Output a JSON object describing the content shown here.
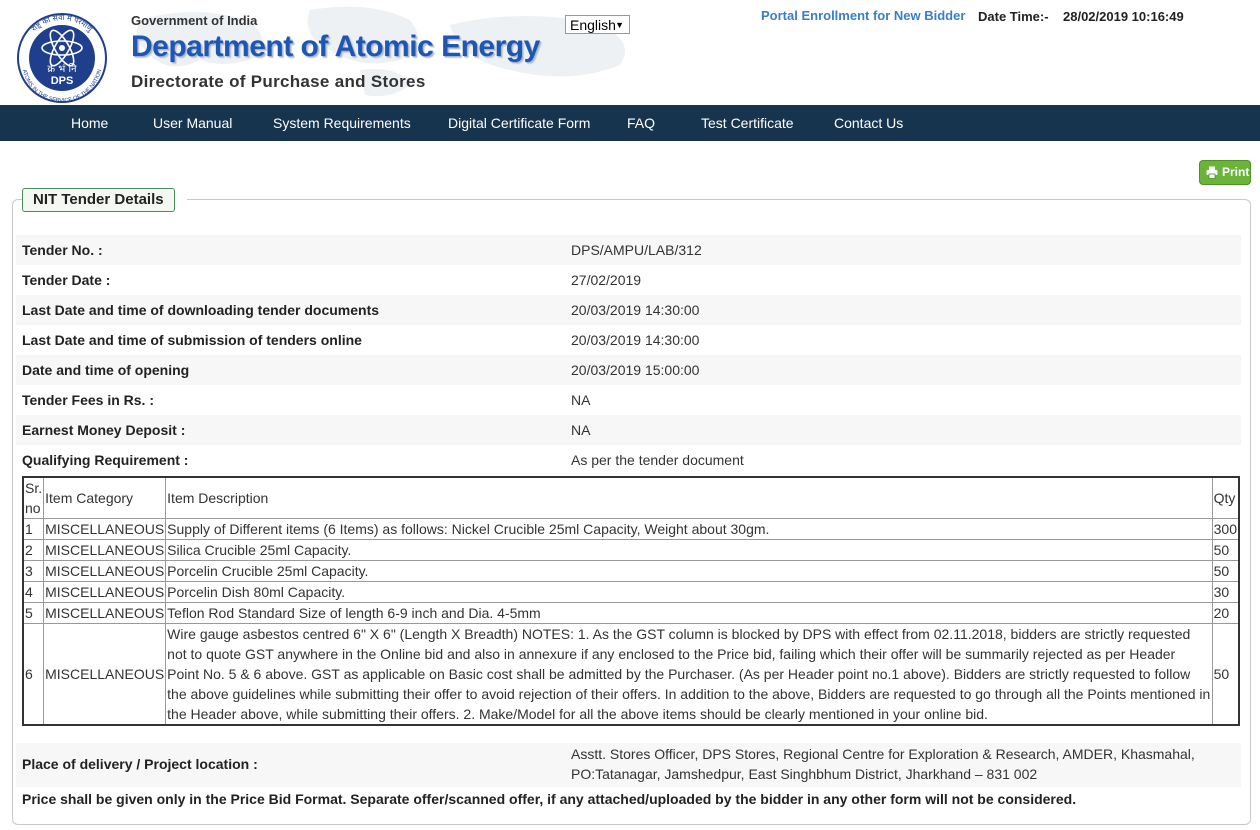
{
  "header": {
    "logo_caption": "DPS",
    "logo_devanagari": "क्र भं नि",
    "logo_arc_text": "राष्ट्र की सेवा में परमाणु",
    "logo_arc_text_bottom": "ATOMS IN THE SERVICE OF THE NATION",
    "gov_text": "Government of India",
    "dept_text": "Department of Atomic Energy",
    "directorate_text": "Directorate of Purchase and Stores",
    "language_selected": "English",
    "portal_link": "Portal Enrollment for New Bidder",
    "datetime_label": "Date Time:-",
    "datetime_value": "28/02/2019 10:16:49"
  },
  "nav": {
    "items": [
      "Home",
      "User Manual",
      "System Requirements",
      "Digital Certificate Form",
      "FAQ",
      "Test Certificate",
      "Contact Us"
    ]
  },
  "print_label": "Print",
  "panel_title": "NIT Tender Details",
  "details": [
    {
      "label": "Tender No. :",
      "value": "DPS/AMPU/LAB/312"
    },
    {
      "label": "Tender Date :",
      "value": "27/02/2019"
    },
    {
      "label": "Last Date and time of downloading tender documents",
      "value": "20/03/2019 14:30:00"
    },
    {
      "label": "Last Date and time of submission of tenders online",
      "value": "20/03/2019 14:30:00"
    },
    {
      "label": "Date and time of opening",
      "value": "20/03/2019 15:00:00"
    },
    {
      "label": "Tender Fees in Rs. :",
      "value": "NA"
    },
    {
      "label": "Earnest Money Deposit :",
      "value": "NA"
    },
    {
      "label": "Qualifying Requirement :",
      "value": "As per the tender document"
    }
  ],
  "items_table": {
    "headers": {
      "sr": "Sr. no",
      "category": "Item Category",
      "description": "Item Description",
      "qty": "Qty"
    },
    "rows": [
      {
        "sr": "1",
        "category": "MISCELLANEOUS",
        "description": "Supply of Different items (6 Items) as follows: Nickel Crucible 25ml Capacity, Weight about 30gm.",
        "qty": "300"
      },
      {
        "sr": "2",
        "category": "MISCELLANEOUS",
        "description": "Silica Crucible 25ml Capacity.",
        "qty": "50"
      },
      {
        "sr": "3",
        "category": "MISCELLANEOUS",
        "description": "Porcelin Crucible 25ml Capacity.",
        "qty": "50"
      },
      {
        "sr": "4",
        "category": "MISCELLANEOUS",
        "description": "Porcelin Dish 80ml Capacity.",
        "qty": "30"
      },
      {
        "sr": "5",
        "category": "MISCELLANEOUS",
        "description": "Teflon Rod Standard Size of length 6-9 inch and Dia. 4-5mm",
        "qty": "20"
      },
      {
        "sr": "6",
        "category": "MISCELLANEOUS",
        "description": "Wire gauge asbestos centred 6\" X 6\" (Length X Breadth) NOTES: 1. As the GST column is blocked by DPS with effect from 02.11.2018, bidders are strictly requested not to quote GST anywhere in the Online bid and also in annexure if any enclosed to the Price bid, failing which their offer will be summarily rejected as per Header Point No. 5 & 6 above. GST as applicable on Basic cost shall be admitted by the Purchaser. (As per Header point no.1 above). Bidders are strictly requested to follow the above guidelines while submitting their offer to avoid rejection of their offers. In addition to the above, Bidders are requested to go through all the Points mentioned in the Header above, while submitting their offers. 2. Make/Model for all the above items should be clearly mentioned in your online bid.",
        "qty": "50"
      }
    ]
  },
  "delivery": {
    "label": "Place of delivery / Project location :",
    "value": "Asstt. Stores Officer, DPS Stores, Regional Centre for Exploration & Research, AMDER, Khasmahal, PO:Tatanagar, Jamshedpur, East Singhbhum District, Jharkhand – 831 002"
  },
  "price_note": "Price shall be given only in the Price Bid Format. Separate offer/scanned offer, if any attached/uploaded by the bidder in any other form will not be considered.",
  "colors": {
    "nav_bg": "#17344f",
    "dept_blue": "#1f56b0",
    "portal_link": "#3a7fc4",
    "print_green": "#6ab43a"
  }
}
